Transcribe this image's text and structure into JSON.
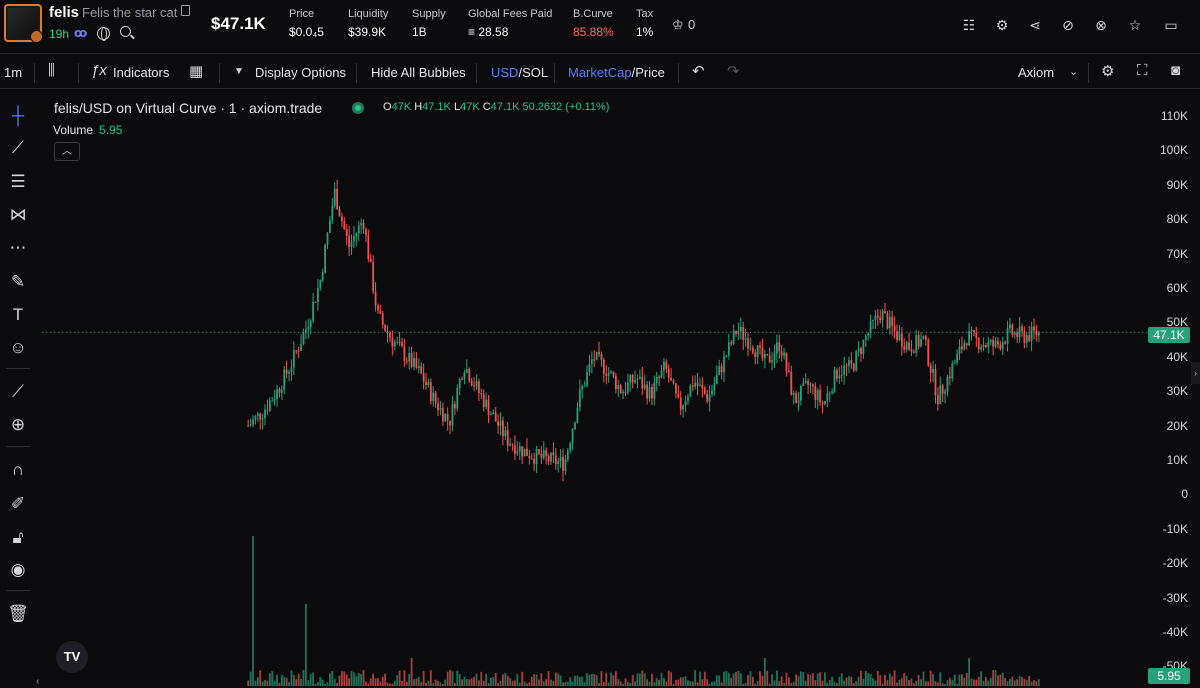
{
  "token": {
    "ticker": "felis",
    "name": "Felis the star cat",
    "age": "19h",
    "market_cap": "$47.1K"
  },
  "stats": [
    {
      "label": "Price",
      "value": "$0.0₄5"
    },
    {
      "label": "Liquidity",
      "value": "$39.9K"
    },
    {
      "label": "Supply",
      "value": "1B"
    },
    {
      "label": "Global Fees Paid",
      "value": "≡ 28.58"
    },
    {
      "label": "B.Curve",
      "value": "85.88%"
    },
    {
      "label": "Tax",
      "value": "1%"
    }
  ],
  "crown_count": "0",
  "colors": {
    "up": "#26a17b",
    "down": "#ef5350",
    "accent": "#5b7cff",
    "bcurve": "#ff6b6b",
    "age": "#2ad58c"
  },
  "toolbar": {
    "interval": "1m",
    "indicators": "Indicators",
    "display_options": "Display Options",
    "hide_bubbles": "Hide All Bubbles",
    "currency_usd": "USD",
    "currency_sol": "/SOL",
    "metric_mcap": "MarketCap",
    "metric_price": "/Price",
    "source": "Axiom"
  },
  "chart": {
    "title": "felis/USD on Virtual Curve · 1 · axiom.trade",
    "ohlc": {
      "o": "47K",
      "h": "47.1K",
      "l": "47K",
      "c": "47.1K",
      "change": "50.2632 (+0.11%)"
    },
    "volume_label": "Volume",
    "volume_value": "5.95",
    "last_price_tag": "47.1K",
    "volume_tag": "5.95"
  },
  "chart_data": {
    "type": "candlestick",
    "y_ticks": [
      "110K",
      "100K",
      "90K",
      "80K",
      "70K",
      "60K",
      "50K",
      "40K",
      "30K",
      "20K",
      "10K",
      "0",
      "-10K",
      "-20K",
      "-30K",
      "-40K",
      "-50K"
    ],
    "ylim": [
      -50000,
      110000
    ],
    "last_price": 47100,
    "close_path_k": [
      20,
      24,
      30,
      38,
      48,
      62,
      88,
      72,
      80,
      52,
      45,
      40,
      35,
      27,
      21,
      38,
      30,
      23,
      16,
      13,
      11,
      10,
      9,
      28,
      40,
      36,
      30,
      34,
      29,
      37,
      25,
      33,
      28,
      38,
      48,
      44,
      38,
      44,
      27,
      32,
      26,
      36,
      37,
      46,
      53,
      47,
      43,
      45,
      28,
      37,
      46,
      44,
      43,
      47,
      46,
      47
    ]
  },
  "icons": {
    "header_right": [
      "list-icon",
      "settings-icon",
      "share-icon",
      "hide-icon",
      "eye-off-icon",
      "star-icon",
      "window-icon"
    ],
    "left_tools": [
      "crosshair-icon",
      "trendline-icon",
      "horizontal-lines-icon",
      "pattern-icon",
      "fib-icon",
      "brush-icon",
      "text-icon",
      "emoji-icon",
      "ruler-icon",
      "zoom-in-icon",
      "magnet-icon",
      "lock-pencil-icon",
      "lock-icon",
      "eye-icon",
      "trash-icon"
    ]
  }
}
